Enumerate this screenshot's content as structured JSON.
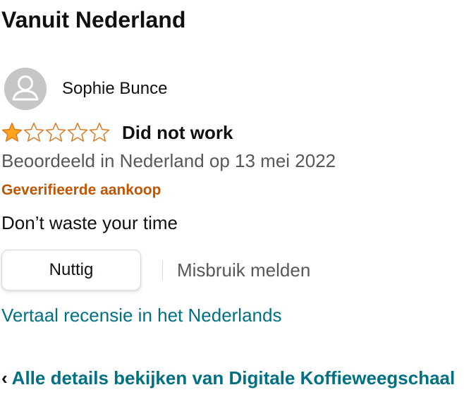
{
  "section": {
    "heading": "Vanuit Nederland"
  },
  "review": {
    "reviewer_name": "Sophie Bunce",
    "rating": 1,
    "rating_max": 5,
    "title": "Did not work",
    "date_text": "Beoordeeld in Nederland op 13 mei 2022",
    "verified_label": "Geverifieerde aankoop",
    "body": "Don’t waste your time"
  },
  "actions": {
    "helpful_label": "Nuttig",
    "report_label": "Misbruik melden"
  },
  "links": {
    "translate_label": "Vertaal recensie in het Nederlands",
    "chevron": "‹",
    "all_details_label": "Alle details bekijken van Digitale Koffieweegschaal"
  },
  "colors": {
    "star_filled": "#ffa41c",
    "star_outline": "#de7921",
    "verified": "#c45500",
    "link": "#007185",
    "muted_text": "#565959"
  }
}
